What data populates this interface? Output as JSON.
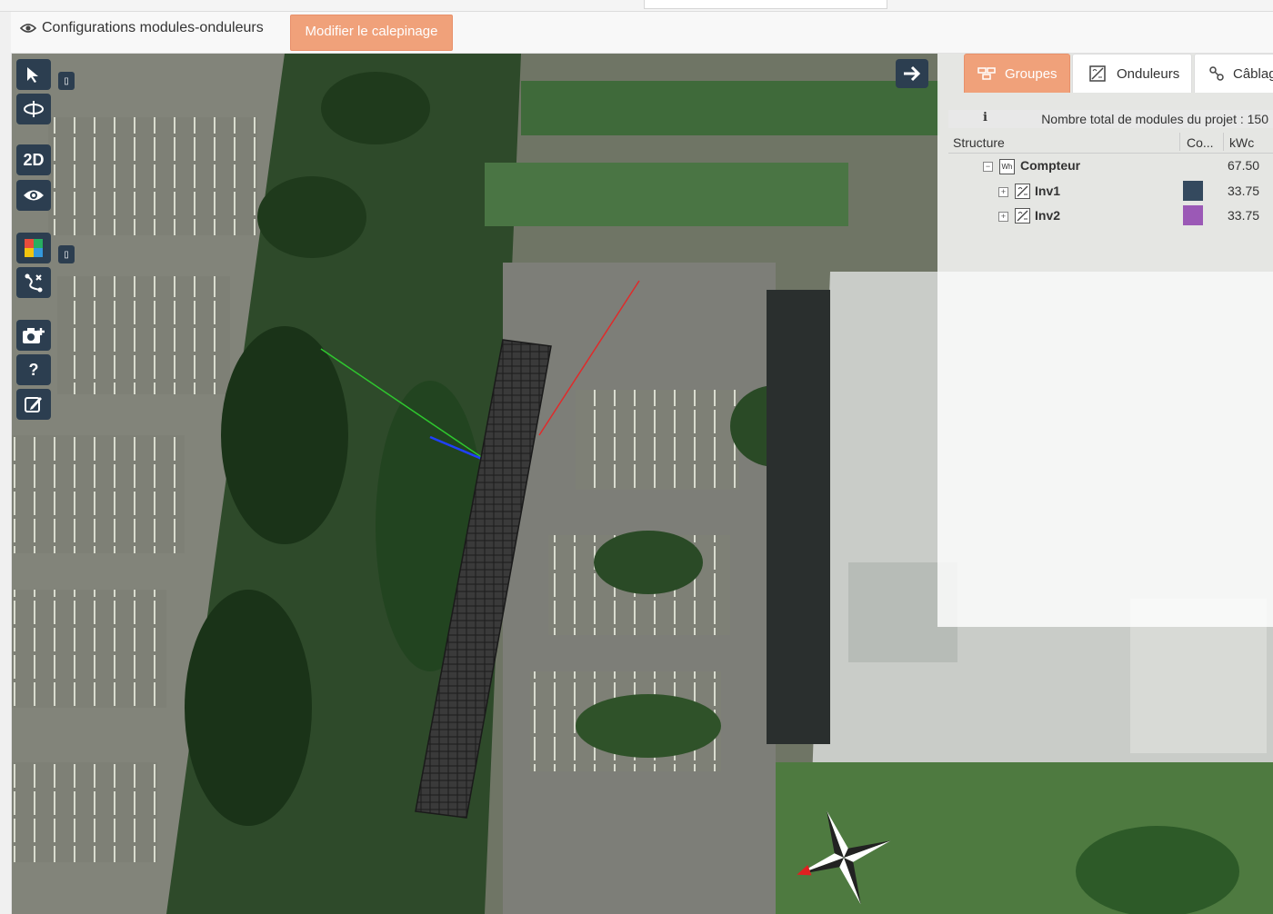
{
  "header": {
    "title": "Configurations modules-onduleurs",
    "edit_button": "Modifier le calepinage"
  },
  "toolbar": {
    "tools": [
      {
        "name": "select-arrow-icon",
        "label": ""
      },
      {
        "name": "orbit-icon",
        "label": ""
      },
      {
        "name": "view-2d-button",
        "label": "2D"
      },
      {
        "name": "eye-icon",
        "label": ""
      },
      {
        "name": "color-palette-icon",
        "label": ""
      },
      {
        "name": "wiring-icon",
        "label": ""
      },
      {
        "name": "camera-add-icon",
        "label": ""
      },
      {
        "name": "help-icon",
        "label": "?"
      },
      {
        "name": "edit-note-icon",
        "label": ""
      }
    ]
  },
  "panel": {
    "tabs": [
      {
        "label": "Groupes",
        "active": true,
        "icon": "groups-icon"
      },
      {
        "label": "Onduleurs",
        "active": false,
        "icon": "inverter-icon"
      },
      {
        "label": "Câblag",
        "active": false,
        "icon": "cable-icon"
      }
    ],
    "info_text": "Nombre total de modules du projet : 150",
    "columns": {
      "structure": "Structure",
      "color": "Co...",
      "kwc": "kWc"
    },
    "rows": [
      {
        "label": "Compteur",
        "kwc": "67.50",
        "color": "",
        "expander": "−"
      },
      {
        "label": "Inv1",
        "kwc": "33.75",
        "color": "#34495e",
        "expander": "+"
      },
      {
        "label": "Inv2",
        "kwc": "33.75",
        "color": "#9b59b6",
        "expander": "+"
      }
    ]
  },
  "compass": {
    "north_color": "#e02020"
  }
}
